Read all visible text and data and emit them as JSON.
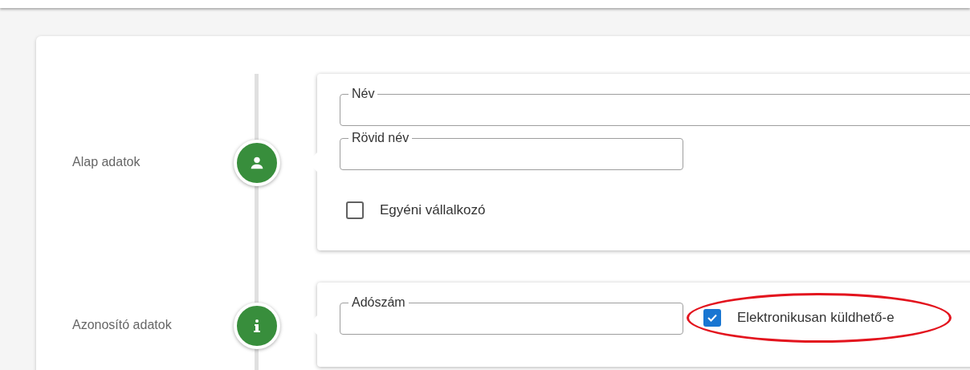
{
  "steps": [
    {
      "label": "Alap adatok",
      "kind": "person",
      "rows": [
        [
          {
            "kind": "wide-field",
            "label": "Név"
          }
        ],
        [
          {
            "kind": "field",
            "label": "Rövid név"
          }
        ],
        [
          {
            "kind": "checkbox",
            "label": "Egyéni vállalkozó",
            "checked": false,
            "highlighted": false
          }
        ]
      ]
    },
    {
      "label": "Azonosító adatok",
      "kind": "info",
      "rows": [
        [
          {
            "kind": "field",
            "label": "Adószám"
          },
          {
            "kind": "checkbox",
            "label": "Elektronikusan küldhető-e",
            "checked": true,
            "highlighted": true
          }
        ]
      ]
    }
  ]
}
